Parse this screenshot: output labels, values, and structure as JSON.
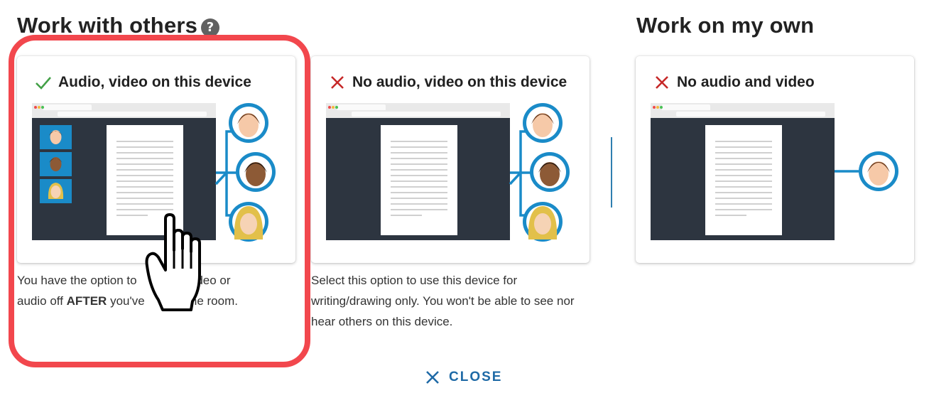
{
  "sections": {
    "work_with_others": "Work with others",
    "work_on_own": "Work on my own",
    "help_icon": "?"
  },
  "cards": {
    "audio_video": {
      "label": "Audio, video on this device",
      "status_icon": "check-icon",
      "description_part1": "You have the option to",
      "description_part2": "video or",
      "description_part3": "audio off",
      "description_bold": "AFTER",
      "description_part4": "you've",
      "description_part5": "the room."
    },
    "no_audio_video": {
      "label": "No audio, video on this device",
      "status_icon": "cross-icon",
      "description": "Select this option to use this device for writing/drawing only. You won't be able to see nor hear others on this device."
    },
    "no_audio_and_video": {
      "label": "No audio and video",
      "status_icon": "cross-icon"
    }
  },
  "close_button": {
    "label": "CLOSE",
    "icon": "close-icon"
  },
  "colors": {
    "check": "#43a047",
    "cross": "#c62828",
    "highlight": "#f2474d",
    "accent": "#1f6aa6",
    "avatar_ring": "#1a8bc8",
    "screen": "#2d3540"
  }
}
